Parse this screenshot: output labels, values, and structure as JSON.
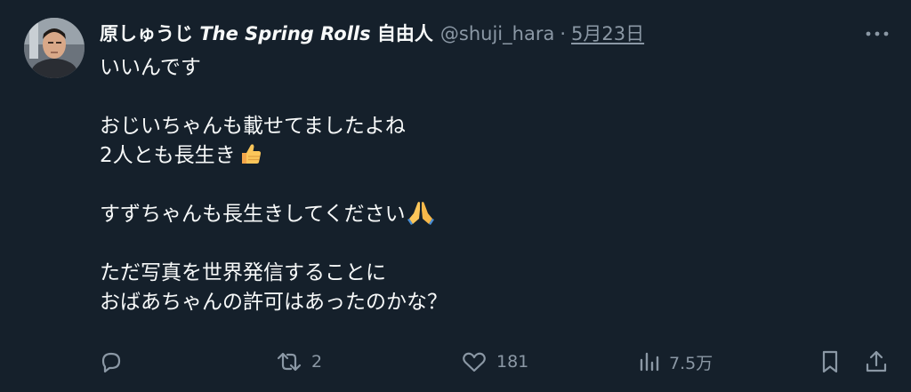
{
  "author": {
    "name_jp": "原しゅうじ ",
    "name_en": "The Spring Rolls",
    "name_suffix": " 自由人",
    "handle": "@shuji_hara",
    "separator": "·",
    "date": "5月23日"
  },
  "body": {
    "line1": "いいんです",
    "line2": "おじいちゃんも載せてましたよね",
    "line3": "2人とも長生き",
    "line4": "すずちゃんも長生きしてください",
    "line5": "ただ写真を世界発信することに",
    "line6": "おばあちゃんの許可はあったのかな？"
  },
  "icons": [
    "more-icon",
    "thumbs-up-emoji",
    "folded-hands-emoji",
    "reply-icon",
    "retweet-icon",
    "like-icon",
    "views-icon",
    "bookmark-icon",
    "share-icon"
  ],
  "stats": {
    "retweets": "2",
    "likes": "181",
    "views": "7.5万"
  },
  "colors": {
    "background": "#15202b",
    "text": "#f7f9f9",
    "muted": "#8b98a5"
  }
}
